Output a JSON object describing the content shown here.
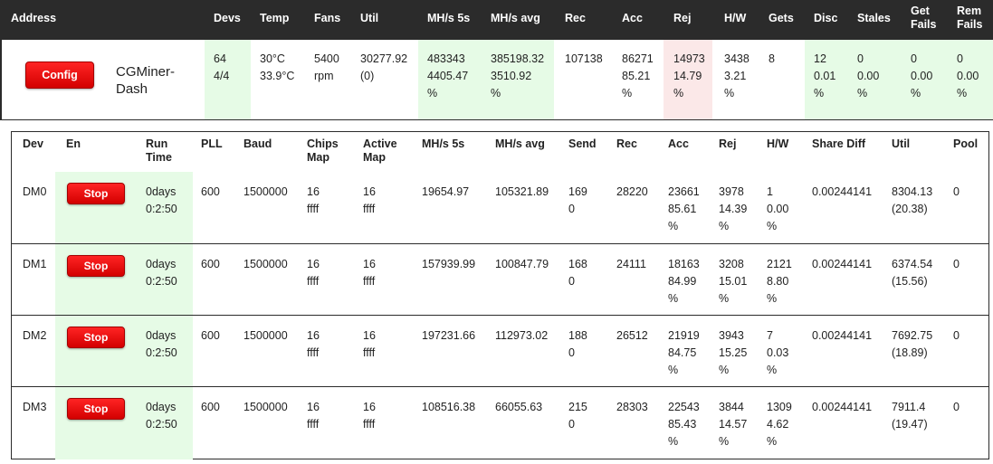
{
  "header": {
    "address": "Address",
    "devs": "Devs",
    "temp": "Temp",
    "fans": "Fans",
    "util": "Util",
    "mhs5s": "MH/s 5s",
    "mhsavg": "MH/s avg",
    "rec": "Rec",
    "acc": "Acc",
    "rej": "Rej",
    "hw": "H/W",
    "gets": "Gets",
    "disc": "Disc",
    "stales": "Stales",
    "getfails": "Get\nFails",
    "remfails": "Rem\nFails"
  },
  "summary": {
    "config_label": "Config",
    "title": "CGMiner-\nDash",
    "devs": "64\n4/4",
    "temp": "30°C\n33.9°C",
    "fans": "5400\nrpm",
    "util": "30277.92\n(0)",
    "mhs5s": "483343\n4405.47\n%",
    "mhsavg": "385198.32\n3510.92\n%",
    "rec": "107138",
    "acc": "86271\n85.21\n%",
    "rej": "14973\n14.79\n%",
    "hw": "3438\n3.21\n%",
    "gets": "8",
    "disc": "12\n0.01\n%",
    "stales": "0\n0.00\n%",
    "getfails": "0\n0.00\n%",
    "remfails": "0\n0.00\n%"
  },
  "devices": {
    "headers": {
      "dev": "Dev",
      "en": "En",
      "runtime": "Run\nTime",
      "pll": "PLL",
      "baud": "Baud",
      "chips": "Chips\nMap",
      "active": "Active\nMap",
      "mhs5s": "MH/s 5s",
      "mhsavg": "MH/s avg",
      "send": "Send",
      "rec": "Rec",
      "acc": "Acc",
      "rej": "Rej",
      "hw": "H/W",
      "sharediff": "Share Diff",
      "util": "Util",
      "pool": "Pool"
    },
    "stop_label": "Stop",
    "rows": [
      {
        "dev": "DM0",
        "runtime": "0days\n0:2:50",
        "pll": "600",
        "baud": "1500000",
        "chips": "16\nffff",
        "active": "16\nffff",
        "mhs5s": "19654.97",
        "mhsavg": "105321.89",
        "send": "169\n0",
        "rec": "28220",
        "acc": "23661\n85.61\n%",
        "rej": "3978\n14.39\n%",
        "hw": "1\n0.00\n%",
        "sharediff": "0.00244141",
        "util": "8304.13\n(20.38)",
        "pool": "0"
      },
      {
        "dev": "DM1",
        "runtime": "0days\n0:2:50",
        "pll": "600",
        "baud": "1500000",
        "chips": "16\nffff",
        "active": "16\nffff",
        "mhs5s": "157939.99",
        "mhsavg": "100847.79",
        "send": "168\n0",
        "rec": "24111",
        "acc": "18163\n84.99\n%",
        "rej": "3208\n15.01\n%",
        "hw": "2121\n8.80\n%",
        "sharediff": "0.00244141",
        "util": "6374.54\n(15.56)",
        "pool": "0"
      },
      {
        "dev": "DM2",
        "runtime": "0days\n0:2:50",
        "pll": "600",
        "baud": "1500000",
        "chips": "16\nffff",
        "active": "16\nffff",
        "mhs5s": "197231.66",
        "mhsavg": "112973.02",
        "send": "188\n0",
        "rec": "26512",
        "acc": "21919\n84.75\n%",
        "rej": "3943\n15.25\n%",
        "hw": "7\n0.03\n%",
        "sharediff": "0.00244141",
        "util": "7692.75\n(18.89)",
        "pool": "0"
      },
      {
        "dev": "DM3",
        "runtime": "0days\n0:2:50",
        "pll": "600",
        "baud": "1500000",
        "chips": "16\nffff",
        "active": "16\nffff",
        "mhs5s": "108516.38",
        "mhsavg": "66055.63",
        "send": "215\n0",
        "rec": "28303",
        "acc": "22543\n85.43\n%",
        "rej": "3844\n14.57\n%",
        "hw": "1309\n4.62\n%",
        "sharediff": "0.00244141",
        "util": "7911.4\n(19.47)",
        "pool": "0"
      }
    ]
  }
}
